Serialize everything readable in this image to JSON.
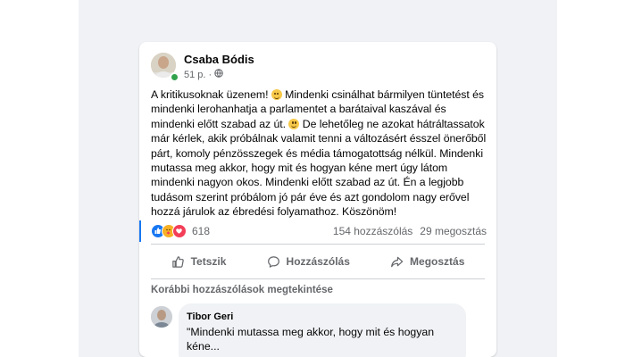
{
  "post": {
    "author": "Csaba Bódis",
    "time": "51 p.",
    "separator": "·",
    "privacy_icon": "globe-icon",
    "text_lines": [
      [
        "A kritikusoknak üzenem! ",
        "emoji",
        " Mindenki csinálhat bármilyen tüntetést és"
      ],
      [
        "mindenki lerohanhatja a parlamentet a barátaival kaszával és"
      ],
      [
        "mindenki előtt szabad az út. ",
        "emoji",
        " De lehetőleg ne azokat hátráltassatok"
      ],
      [
        "már kérlek, akik próbálnak valamit tenni a változásért ésszel önerőből"
      ],
      [
        "párt, komoly pénzösszegek és média támogatottság nélkül. Mindenki"
      ],
      [
        "mutassa meg akkor, hogy mit és hogyan kéne mert úgy látom"
      ],
      [
        "mindenki nagyon okos. Mindenki előtt szabad az út. Én a legjobb"
      ],
      [
        "tudásom szerint próbálom jó pár éve és azt gondolom nagy erővel"
      ],
      [
        "hozzá járulok az ébredési folyamathoz. Köszönöm!"
      ]
    ],
    "reaction_icons": [
      "like-reaction",
      "care-reaction",
      "love-reaction"
    ],
    "reaction_count": "618",
    "comments_count": "154 hozzászólás",
    "shares_count": "29 megosztás"
  },
  "actions": {
    "like": "Tetszik",
    "comment": "Hozzászólás",
    "share": "Megosztás"
  },
  "comments": {
    "previous_label": "Korábbi hozzászólások megtekintése",
    "items": [
      {
        "author": "Tibor Geri",
        "text": "\"Mindenki mutassa meg akkor, hogy mit és hogyan kéne..."
      }
    ]
  },
  "colors": {
    "brand_blue": "#1877f2",
    "secondary_text": "#65676b",
    "feed_background": "#f0f2f5"
  }
}
